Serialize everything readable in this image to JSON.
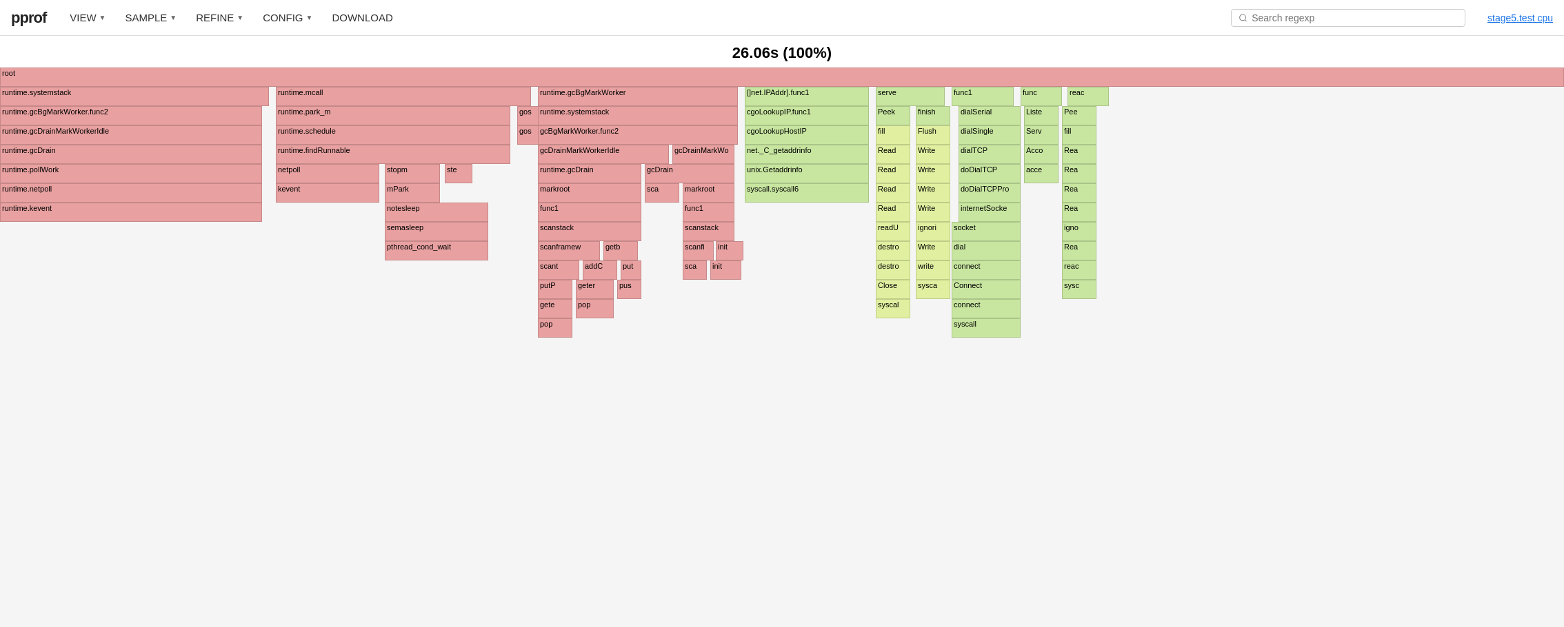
{
  "header": {
    "logo": "pprof",
    "nav": [
      {
        "label": "VIEW",
        "id": "view"
      },
      {
        "label": "SAMPLE",
        "id": "sample"
      },
      {
        "label": "REFINE",
        "id": "refine"
      },
      {
        "label": "CONFIG",
        "id": "config"
      },
      {
        "label": "DOWNLOAD",
        "id": "download"
      }
    ],
    "search_placeholder": "Search regexp",
    "profile_link": "stage5.test cpu"
  },
  "main": {
    "title": "26.06s (100%)"
  }
}
